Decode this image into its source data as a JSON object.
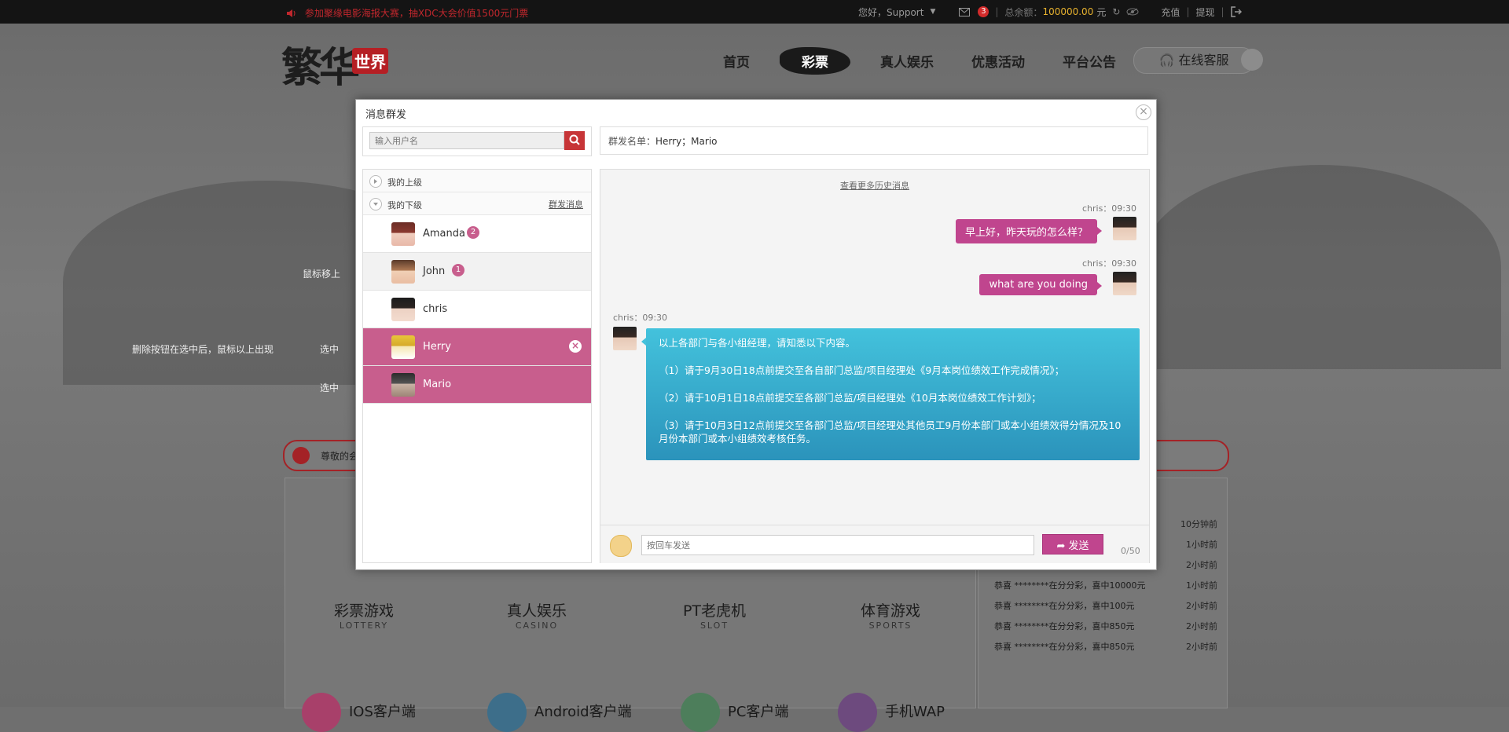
{
  "topbar": {
    "notice": "参加聚缘电影海报大赛，抽XDC大会价值1500元门票",
    "greeting": "您好，Support",
    "mail_count": "3",
    "balance_label": "总余额：",
    "balance_value": "100000.00",
    "balance_unit": "元",
    "recharge": "充值",
    "withdraw": "提现",
    "separator": "|"
  },
  "site": {
    "logo_text": "繁华",
    "logo_seal": "世界",
    "nav": [
      "首页",
      "彩票",
      "真人娱乐",
      "优惠活动",
      "平台公告"
    ],
    "active_nav": "彩票",
    "service": "在线客服",
    "bulletin": "尊敬的会",
    "notes": {
      "hover": "鼠标移上",
      "delete_hint": "删除按钮在选中后，鼠标以上出现",
      "selected1": "选中",
      "selected2": "选中"
    },
    "games": [
      {
        "name": "彩票游戏",
        "sub": "LOTTERY"
      },
      {
        "name": "真人娱乐",
        "sub": "CASINO"
      },
      {
        "name": "PT老虎机",
        "sub": "SLOT"
      },
      {
        "name": "体育游戏",
        "sub": "SPORTS"
      }
    ],
    "clients": [
      "IOS客户端",
      "Android客户端",
      "PC客户端",
      "手机WAP"
    ],
    "winners": [
      {
        "text": "",
        "time": "10分钟前"
      },
      {
        "text": "",
        "time": "1小时前"
      },
      {
        "text": "",
        "time": "2小时前"
      },
      {
        "text": "恭喜 ********在分分彩，喜中10000元",
        "time": "1小时前"
      },
      {
        "text": "恭喜 ********在分分彩，喜中100元",
        "time": "2小时前"
      },
      {
        "text": "恭喜 ********在分分彩，喜中850元",
        "time": "2小时前"
      },
      {
        "text": "恭喜 ********在分分彩，喜中850元",
        "time": "2小时前"
      }
    ]
  },
  "modal": {
    "title": "消息群发",
    "close_icon": "×",
    "search_placeholder": "输入用户名",
    "groups": {
      "superior": "我的上级",
      "subordinate": "我的下级",
      "broadcast": "群发消息"
    },
    "users": [
      {
        "name": "Amanda",
        "badge": "2",
        "state": "normal"
      },
      {
        "name": "John",
        "badge": "1",
        "state": "hover"
      },
      {
        "name": "chris",
        "badge": "",
        "state": "normal"
      },
      {
        "name": "Herry",
        "badge": "",
        "state": "selected"
      },
      {
        "name": "Mario",
        "badge": "",
        "state": "selected"
      }
    ],
    "recipients_label": "群发名单：",
    "recipients": "Herry；Mario",
    "history_link": "查看更多历史消息",
    "messages": [
      {
        "sender": "chris：09:30",
        "text": "早上好，昨天玩的怎么样？"
      },
      {
        "sender": "chris：09:30",
        "text": "what are you doing"
      },
      {
        "sender": "chris：09:30",
        "lines": [
          "以上各部门与各小组经理，请知悉以下内容。",
          "（1）请于9月30日18点前提交至各自部门总监/项目经理处《9月本岗位绩效工作完成情况》；",
          "（2）请于10月1日18点前提交至各部门总监/项目经理处《10月本岗位绩效工作计划》；",
          "（3）请于10月3日12点前提交至各部门总监/项目经理处其他员工9月份本部门或本小组绩效得分情况及10月份本部门或本小组绩效考核任务。"
        ]
      }
    ],
    "compose_placeholder": "按回车发送",
    "send": "发送",
    "char_count": "0/50"
  },
  "colors": {
    "accent": "#c0458e",
    "selected_row": "#c85e8d",
    "incoming_bubble": "#3aaed0",
    "brand_red": "#c73537"
  },
  "icons": [
    "speaker-icon",
    "mail-icon",
    "refresh-icon",
    "eye-off-icon",
    "logout-icon",
    "headset-icon",
    "arrow-up-icon",
    "search-icon",
    "close-icon",
    "expand-icon",
    "collapse-icon",
    "emoji-icon",
    "send-icon"
  ]
}
